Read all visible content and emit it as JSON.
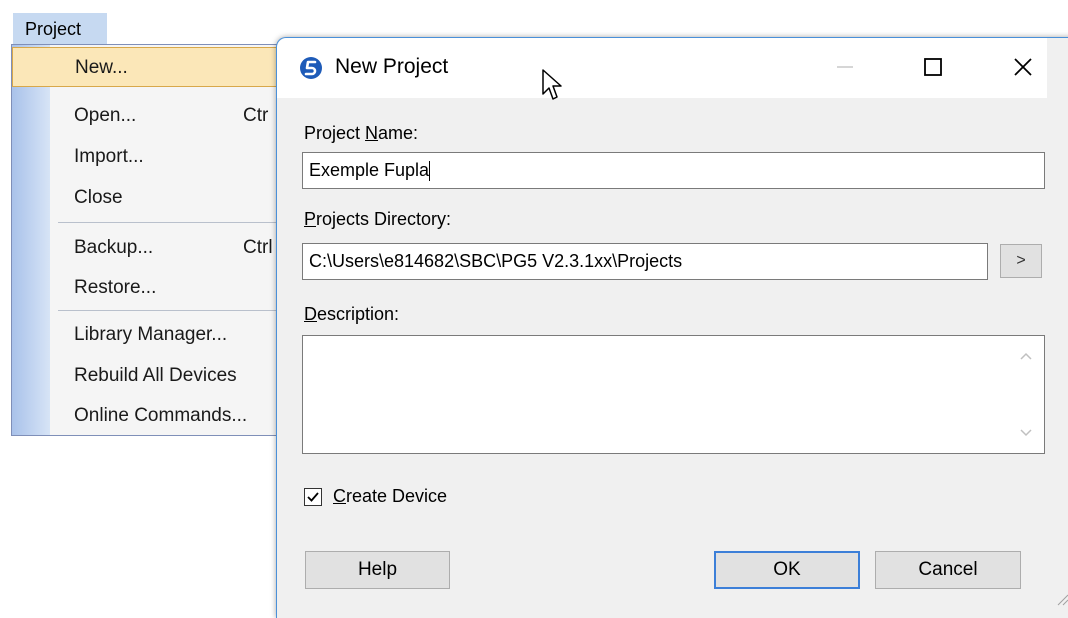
{
  "menu": {
    "title": "Project",
    "items": [
      {
        "label": "New...",
        "shortcut": ""
      },
      {
        "label": "Open...",
        "shortcut": "Ctr"
      },
      {
        "label": "Import...",
        "shortcut": ""
      },
      {
        "label": "Close",
        "shortcut": ""
      },
      {
        "label": "Backup...",
        "shortcut": "Ctrl"
      },
      {
        "label": "Restore...",
        "shortcut": ""
      },
      {
        "label": "Library Manager...",
        "shortcut": ""
      },
      {
        "label": "Rebuild All Devices",
        "shortcut": ""
      },
      {
        "label": "Online Commands...",
        "shortcut": ""
      }
    ]
  },
  "dialog": {
    "title": "New Project",
    "project_name_label_pre": "Project ",
    "project_name_label_key": "N",
    "project_name_label_post": "ame:",
    "project_name_value": "Exemple Fupla",
    "directory_label_key": "P",
    "directory_label_post": "rojects Directory:",
    "directory_value": "C:\\Users\\e814682\\SBC\\PG5 V2.3.1xx\\Projects",
    "browse_label": ">",
    "description_label_key": "D",
    "description_label_post": "escription:",
    "description_value": "",
    "create_device_key": "C",
    "create_device_post": "reate Device",
    "create_device_checked": true,
    "help_label": "Help",
    "ok_label": "OK",
    "cancel_label": "Cancel"
  },
  "colors": {
    "menu_highlight": "#fbe7b8",
    "menu_gutter": "#a9c2ea",
    "dialog_border": "#4a90d9",
    "default_button_border": "#3c7fd8",
    "app_icon": "#1e5bb8"
  },
  "icons": {
    "app": "pg5-logo-icon",
    "minimize": "minimize-icon",
    "maximize": "maximize-icon",
    "close": "close-icon",
    "cursor": "mouse-pointer-icon"
  }
}
